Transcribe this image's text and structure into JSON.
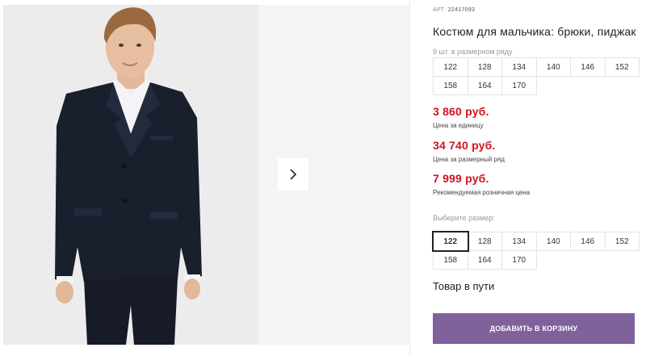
{
  "product": {
    "article_label": "АРТ:",
    "article_number": "22417093",
    "title": "Костюм для мальчика: брюки, пиджак",
    "series_label": "9 шт. в размерном ряду",
    "series_sizes": [
      "122",
      "128",
      "134",
      "140",
      "146",
      "152",
      "158",
      "164",
      "170"
    ]
  },
  "prices": {
    "unit_price": "3 860 руб.",
    "unit_note": "Цена за единицу",
    "series_price": "34 740 руб.",
    "series_note": "Цена за размерный ряд",
    "retail_price": "7 999 руб.",
    "retail_note": "Рекомендуемая розничная цена",
    "price_color": "#d3121e"
  },
  "size_picker": {
    "label": "Выберите размер:",
    "sizes": [
      "122",
      "128",
      "134",
      "140",
      "146",
      "152",
      "158",
      "164",
      "170"
    ],
    "selected": "122"
  },
  "status_text": "Товар в пути",
  "cart_button_label": "ДОБАВИТЬ В КОРЗИНУ",
  "colors": {
    "accent": "#7f619b",
    "suit": "#1a1f2e"
  },
  "icons": {
    "next": "chevron-right-icon"
  }
}
